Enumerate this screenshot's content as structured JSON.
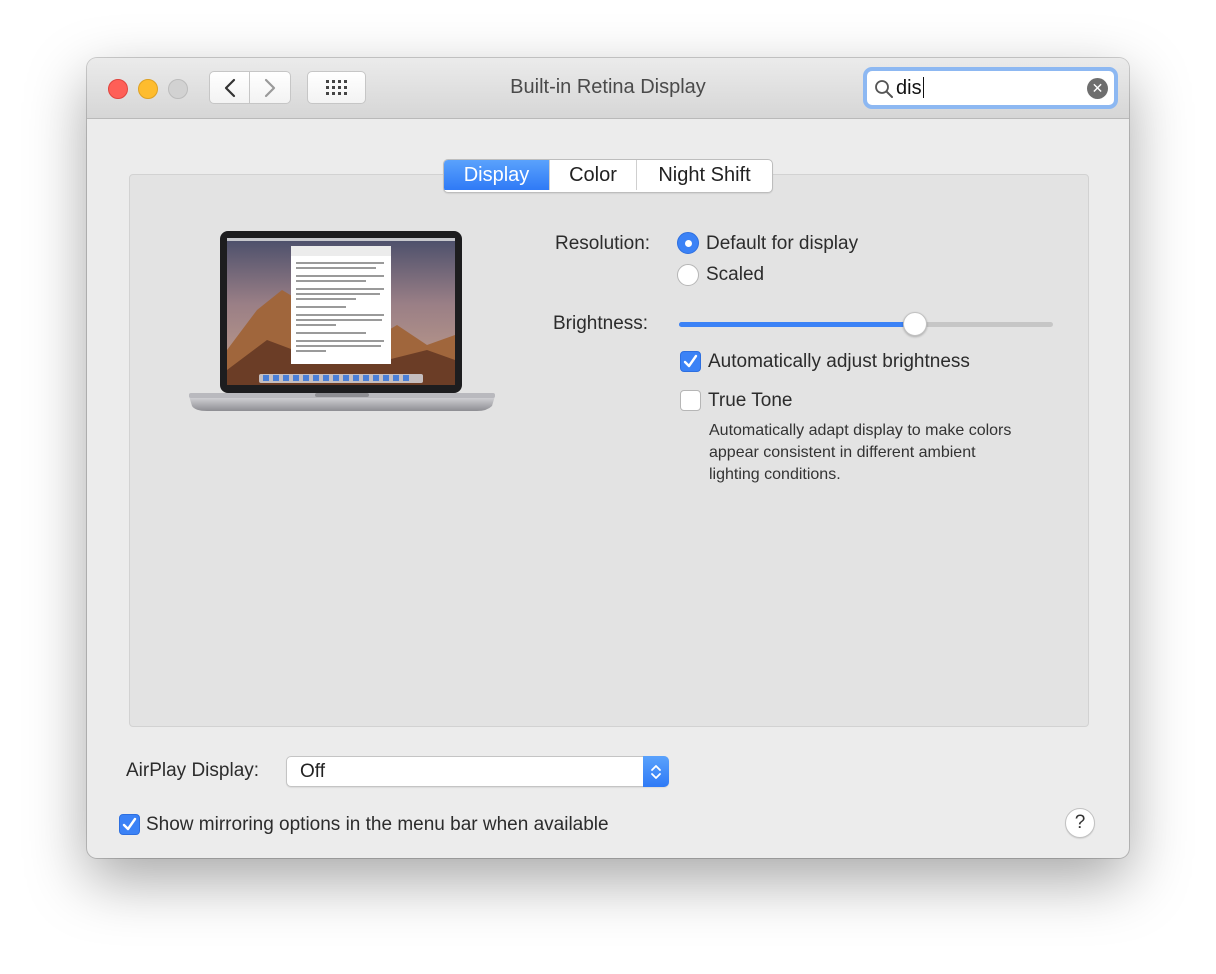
{
  "window": {
    "title": "Built-in Retina Display",
    "accent_color": "#3b82f6"
  },
  "toolbar": {
    "back_icon": "chevron-left",
    "forward_icon": "chevron-right",
    "show_all_icon": "grid"
  },
  "search": {
    "value": "dis",
    "icon": "magnifier",
    "clear_icon": "x-circle"
  },
  "tabs": [
    {
      "label": "Display",
      "selected": true
    },
    {
      "label": "Color",
      "selected": false
    },
    {
      "label": "Night Shift",
      "selected": false
    }
  ],
  "resolution": {
    "label": "Resolution:",
    "options": [
      {
        "label": "Default for display",
        "selected": true
      },
      {
        "label": "Scaled",
        "selected": false
      }
    ]
  },
  "brightness": {
    "label": "Brightness:",
    "value": 0.63
  },
  "auto_brightness": {
    "label": "Automatically adjust brightness",
    "checked": true
  },
  "true_tone": {
    "label": "True Tone",
    "checked": false,
    "description": "Automatically adapt display to make colors\nappear consistent in different ambient\nlighting conditions."
  },
  "airplay": {
    "label": "AirPlay Display:",
    "value": "Off"
  },
  "mirroring": {
    "label": "Show mirroring options in the menu bar when available",
    "checked": true
  },
  "help": {
    "label": "?"
  }
}
